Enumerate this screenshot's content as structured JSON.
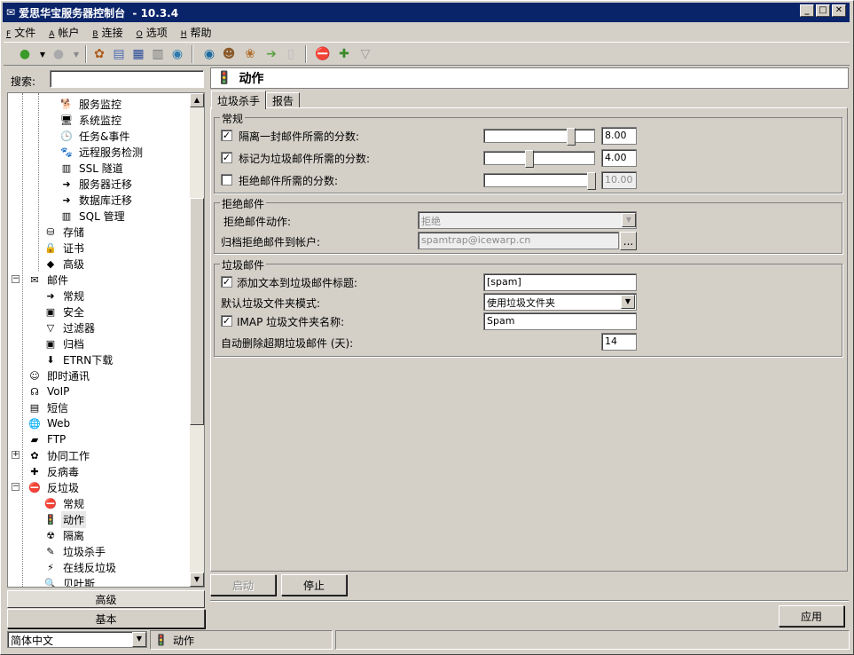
{
  "window": {
    "title": "爱思华宝服务器控制台  - 10.3.4"
  },
  "menu": [
    {
      "key": "F",
      "label": "文件"
    },
    {
      "key": "A",
      "label": "帐户"
    },
    {
      "key": "B",
      "label": "连接"
    },
    {
      "key": "O",
      "label": "选项"
    },
    {
      "key": "H",
      "label": "帮助"
    }
  ],
  "search": {
    "label": "搜索:",
    "value": ""
  },
  "tree": [
    {
      "label": "服务监控",
      "icon": "dog-icon",
      "iconChar": "🐕",
      "level": 3
    },
    {
      "label": "系统监控",
      "icon": "monitor-icon",
      "iconChar": "🖥",
      "level": 3
    },
    {
      "label": "任务&事件",
      "icon": "clock-icon",
      "iconChar": "🕒",
      "level": 3
    },
    {
      "label": "远程服务检测",
      "icon": "paw-icon",
      "iconChar": "🐾",
      "level": 3
    },
    {
      "label": "SSL 隧道",
      "icon": "chart-icon",
      "iconChar": "▥",
      "level": 3
    },
    {
      "label": "服务器迁移",
      "icon": "migrate-icon",
      "iconChar": "➜",
      "level": 3
    },
    {
      "label": "数据库迁移",
      "icon": "db-migrate-icon",
      "iconChar": "➜",
      "level": 3
    },
    {
      "label": "SQL 管理",
      "icon": "chart-icon",
      "iconChar": "▥",
      "level": 3
    },
    {
      "label": "存储",
      "icon": "storage-icon",
      "iconChar": "⛁",
      "level": 2
    },
    {
      "label": "证书",
      "icon": "certificate-icon",
      "iconChar": "🔒",
      "level": 2
    },
    {
      "label": "高级",
      "icon": "advanced-icon",
      "iconChar": "◆",
      "level": 2
    },
    {
      "label": "邮件",
      "icon": "mail-icon",
      "iconChar": "✉",
      "level": 1,
      "expander": "−"
    },
    {
      "label": "常规",
      "icon": "general-icon",
      "iconChar": "➜",
      "level": 2
    },
    {
      "label": "安全",
      "icon": "security-icon",
      "iconChar": "▣",
      "level": 2
    },
    {
      "label": "过滤器",
      "icon": "filter-icon",
      "iconChar": "▽",
      "level": 2
    },
    {
      "label": "归档",
      "icon": "archive-icon",
      "iconChar": "▣",
      "level": 2
    },
    {
      "label": "ETRN下载",
      "icon": "download-icon",
      "iconChar": "⬇",
      "level": 2
    },
    {
      "label": "即时通讯",
      "icon": "im-icon",
      "iconChar": "☺",
      "level": 1
    },
    {
      "label": "VoIP",
      "icon": "headset-icon",
      "iconChar": "☊",
      "level": 1
    },
    {
      "label": "短信",
      "icon": "phone-icon",
      "iconChar": "▤",
      "level": 1
    },
    {
      "label": "Web",
      "icon": "globe-icon",
      "iconChar": "🌐",
      "level": 1
    },
    {
      "label": "FTP",
      "icon": "folder-icon",
      "iconChar": "▰",
      "level": 1
    },
    {
      "label": "协同工作",
      "icon": "groupware-icon",
      "iconChar": "✿",
      "level": 1,
      "expander": "+"
    },
    {
      "label": "反病毒",
      "icon": "antivirus-icon",
      "iconChar": "✚",
      "level": 1
    },
    {
      "label": "反垃圾",
      "icon": "stop-icon",
      "iconChar": "⛔",
      "level": 1,
      "expander": "−"
    },
    {
      "label": "常规",
      "icon": "stop-icon",
      "iconChar": "⛔",
      "level": 2
    },
    {
      "label": "动作",
      "icon": "traffic-light-icon",
      "iconChar": "🚦",
      "level": 2,
      "selected": true
    },
    {
      "label": "隔离",
      "icon": "quarantine-icon",
      "iconChar": "☢",
      "level": 2
    },
    {
      "label": "垃圾杀手",
      "icon": "spam-killer-icon",
      "iconChar": "✎",
      "level": 2
    },
    {
      "label": "在线反垃圾",
      "icon": "online-antispam-icon",
      "iconChar": "⚡",
      "level": 2
    },
    {
      "label": "贝叶斯",
      "icon": "bayes-icon",
      "iconChar": "🔍",
      "level": 2
    }
  ],
  "bottom_left": {
    "advanced": "高级",
    "basic": "基本"
  },
  "panel": {
    "title": "动作"
  },
  "tabs": [
    {
      "label": "垃圾杀手",
      "active": true
    },
    {
      "label": "报告",
      "active": false
    }
  ],
  "general": {
    "title": "常规",
    "rows": [
      {
        "label": "隔离一封邮件所需的分数:",
        "checked": "✓",
        "value": "8.00",
        "level": 0.8,
        "disabled": false
      },
      {
        "label": "标记为垃圾邮件所需的分数:",
        "checked": "✓",
        "value": "4.00",
        "level": 0.4,
        "disabled": false
      },
      {
        "label": "拒绝邮件所需的分数:",
        "checked": "",
        "value": "10.00",
        "level": 1.0,
        "disabled": true
      }
    ]
  },
  "reject": {
    "title": "拒绝邮件",
    "action_label": "拒绝邮件动作:",
    "action_value": "拒绝",
    "archive_label": "归档拒绝邮件到帐户:",
    "archive_value": "spamtrap@icewarp.cn",
    "browse": "..."
  },
  "spam": {
    "title": "垃圾邮件",
    "add_text_label": "添加文本到垃圾邮件标题:",
    "add_text_checked": "✓",
    "add_text_value": "[spam]",
    "folder_mode_label": "默认垃圾文件夹模式:",
    "folder_mode_value": "使用垃圾文件夹",
    "imap_label": "IMAP 垃圾文件夹名称:",
    "imap_checked": "✓",
    "imap_value": "Spam",
    "autodelete_label": "自动删除超期垃圾邮件 (天):",
    "autodelete_value": "14"
  },
  "buttons": {
    "start": "启动",
    "stop": "停止",
    "apply": "应用"
  },
  "statusbar": {
    "language": "简体中文",
    "current": "动作"
  }
}
